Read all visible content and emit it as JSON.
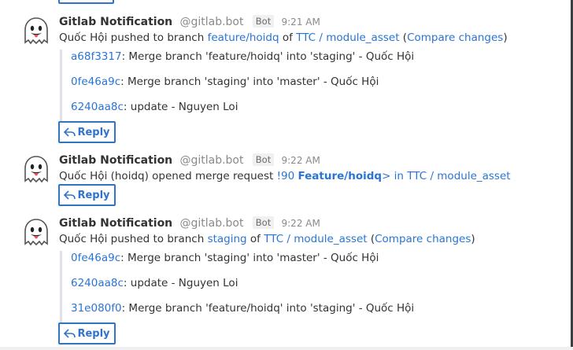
{
  "colors": {
    "link": "#2a75d3",
    "button_border": "#2f74c9",
    "muted": "#8a8a8a"
  },
  "posts": [
    {
      "sender": "Gitlab Notification",
      "handle": "@gitlab.bot",
      "badge": "Bot",
      "time": "9:21 AM",
      "message": {
        "actor": "Quốc Hội",
        "action": "pushed to branch",
        "branch": "feature/hoidq",
        "of": "of",
        "repo": "TTC / module_asset",
        "open_paren": "(",
        "compare": "Compare changes",
        "close_paren": ")"
      },
      "commits": [
        {
          "sha": "a68f3317",
          "text": ": Merge branch 'feature/hoidq' into 'staging' - Quốc Hội"
        },
        {
          "sha": "0fe46a9c",
          "text": ": Merge branch 'staging' into 'master' - Quốc Hội"
        },
        {
          "sha": "6240aa8c",
          "text": ": update - Nguyen Loi"
        }
      ],
      "reply_label": "Reply"
    },
    {
      "sender": "Gitlab Notification",
      "handle": "@gitlab.bot",
      "badge": "Bot",
      "time": "9:22 AM",
      "message": {
        "actor": "Quốc Hội (hoidq)",
        "action": "opened merge request",
        "mr_number": "!90",
        "mr_title": "Feature/hoidq",
        "mr_suffix": "> in TTC / module_asset"
      },
      "reply_label": "Reply"
    },
    {
      "sender": "Gitlab Notification",
      "handle": "@gitlab.bot",
      "badge": "Bot",
      "time": "9:22 AM",
      "message": {
        "actor": "Quốc Hội",
        "action": "pushed to branch",
        "branch": "staging",
        "of": "of",
        "repo": "TTC / module_asset",
        "open_paren": "(",
        "compare": "Compare changes",
        "close_paren": ")"
      },
      "commits": [
        {
          "sha": "0fe46a9c",
          "text": ": Merge branch 'staging' into 'master' - Quốc Hội"
        },
        {
          "sha": "6240aa8c",
          "text": ": update - Nguyen Loi"
        },
        {
          "sha": "31e080f0",
          "text": ": Merge branch 'feature/hoidq' into 'staging' - Quốc Hội"
        }
      ],
      "reply_label": "Reply"
    }
  ]
}
